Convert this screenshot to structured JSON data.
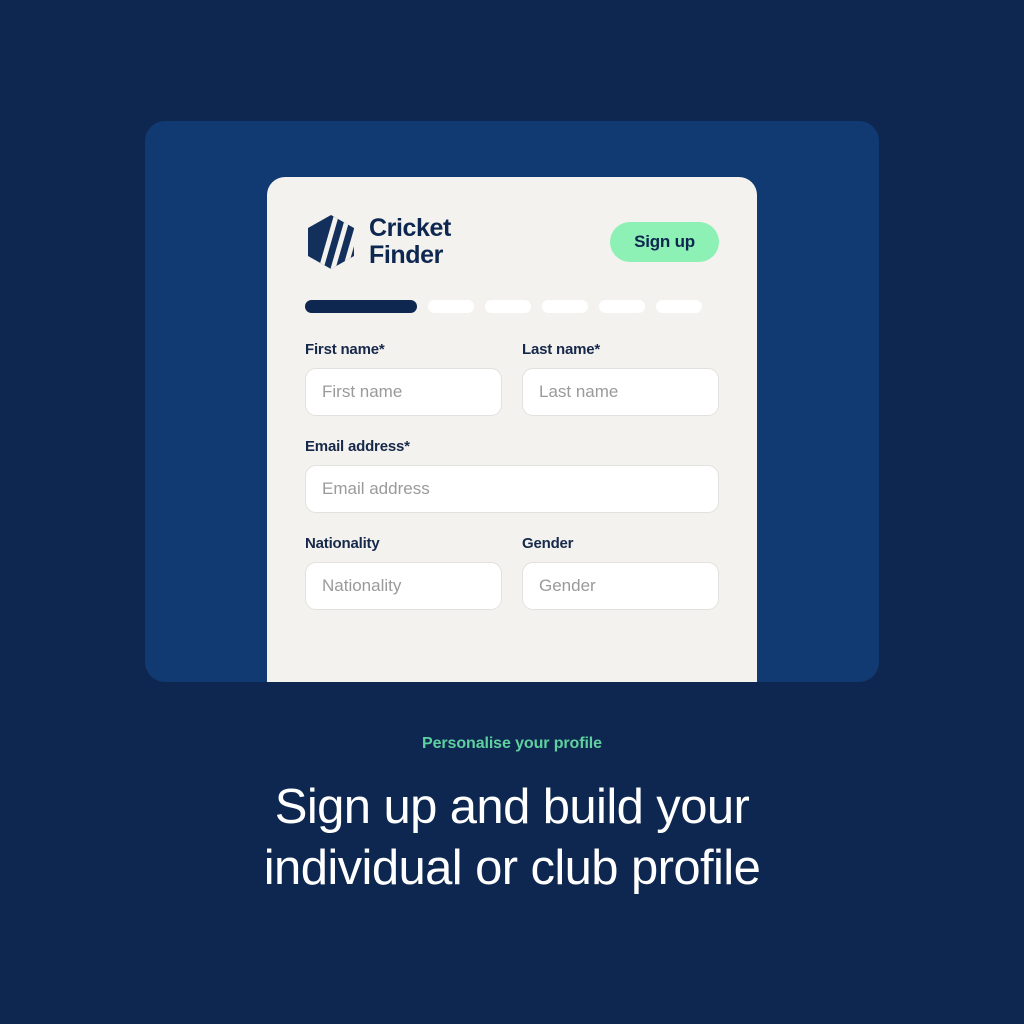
{
  "theme": {
    "page_background": "#0e2750",
    "panel_background": "#123a72",
    "card_background": "#f4f2ee",
    "accent_mint": "#8df0b4",
    "accent_green_text": "#5fd0a0",
    "navy_text": "#16294a",
    "input_background": "#ffffff",
    "placeholder_color": "#9a9a9a"
  },
  "card": {
    "brand": {
      "logo_icon": "hexagon-stripes-logo",
      "name_line1": "Cricket",
      "name_line2": "Finder"
    },
    "signup_button_label": "Sign up",
    "steps": {
      "total": 6,
      "active_index": 0
    },
    "form": {
      "rows": [
        {
          "fields": [
            {
              "label": "First name*",
              "placeholder": "First name",
              "value": "",
              "name": "first-name"
            },
            {
              "label": "Last name*",
              "placeholder": "Last name",
              "value": "",
              "name": "last-name"
            }
          ]
        },
        {
          "fields": [
            {
              "label": "Email address*",
              "placeholder": "Email address",
              "value": "",
              "name": "email-address"
            }
          ]
        },
        {
          "fields": [
            {
              "label": "Nationality",
              "placeholder": "Nationality",
              "value": "",
              "name": "nationality"
            },
            {
              "label": "Gender",
              "placeholder": "Gender",
              "value": "",
              "name": "gender"
            }
          ]
        }
      ]
    }
  },
  "caption": {
    "eyebrow": "Personalise your profile",
    "headline": "Sign up and build your individual or club profile"
  }
}
